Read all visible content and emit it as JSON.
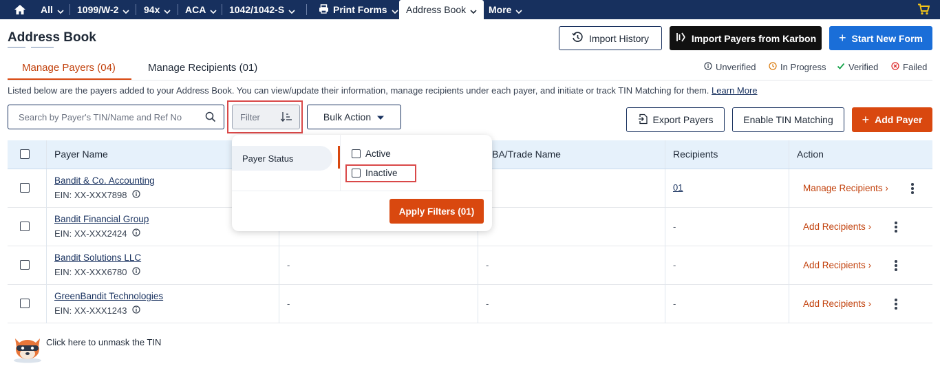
{
  "nav": {
    "items": [
      {
        "label": "All"
      },
      {
        "label": "1099/W-2"
      },
      {
        "label": "94x"
      },
      {
        "label": "ACA"
      },
      {
        "label": "1042/1042-S"
      },
      {
        "label": "Print Forms"
      },
      {
        "label": "Address Book"
      },
      {
        "label": "More"
      }
    ],
    "home_icon": "home-icon",
    "cart_icon": "cart-icon"
  },
  "header": {
    "title": "Address Book",
    "import_history": "Import History",
    "import_karbon": "Import Payers from Karbon",
    "start_new_form": "Start New Form"
  },
  "tabs": [
    {
      "label": "Manage Payers (04)",
      "active": true
    },
    {
      "label": "Manage Recipients (01)",
      "active": false
    }
  ],
  "status_legend": [
    {
      "label": "Unverified",
      "color": "#374151"
    },
    {
      "label": "In Progress",
      "color": "#d97706"
    },
    {
      "label": "Verified",
      "color": "#16a34a"
    },
    {
      "label": "Failed",
      "color": "#dc2626"
    }
  ],
  "description": {
    "text": "Listed below are the payers added to your Address Book. You can view/update their information, manage recipients under each payer, and initiate or track TIN Matching for them.",
    "link": "Learn More"
  },
  "search": {
    "placeholder": "Search by Payer's TIN/Name and Ref No"
  },
  "filter": {
    "placeholder": "Filter"
  },
  "bulk_action": "Bulk Action",
  "export_payers": "Export Payers",
  "enable_tin": "Enable TIN Matching",
  "add_payer": "Add Payer",
  "table": {
    "columns": [
      "Payer Name",
      "DBA/Trade Name",
      "Recipients",
      "Action"
    ],
    "rows": [
      {
        "name": "Bandit & Co. Accounting",
        "ein": "EIN: XX-XXX7898",
        "col2": "",
        "col3": "",
        "recipients": "01",
        "action": "Manage Recipients"
      },
      {
        "name": "Bandit Financial Group",
        "ein": "EIN: XX-XXX2424",
        "col2": "",
        "col3": "",
        "recipients": "-",
        "action": "Add Recipients"
      },
      {
        "name": "Bandit Solutions LLC",
        "ein": "EIN: XX-XXX6780",
        "col2": "-",
        "col3": "-",
        "recipients": "-",
        "action": "Add Recipients"
      },
      {
        "name": "GreenBandit Technologies",
        "ein": "EIN: XX-XXX1243",
        "col2": "-",
        "col3": "-",
        "recipients": "-",
        "action": "Add Recipients"
      }
    ]
  },
  "filter_popup": {
    "category": "Payer Status",
    "options": [
      {
        "label": "Active",
        "checked": false
      },
      {
        "label": "Inactive",
        "checked": false
      }
    ],
    "apply": "Apply Filters (01)"
  },
  "footer": {
    "text": "Click here to unmask the TIN"
  },
  "colors": {
    "nav_bg": "#17305e",
    "accent": "#d9480f",
    "primary_blue": "#1a6ed8"
  }
}
